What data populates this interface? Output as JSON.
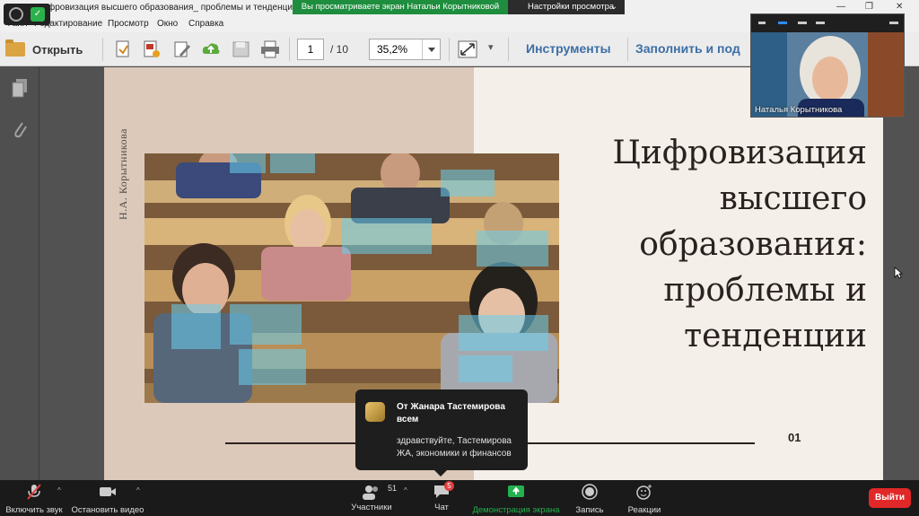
{
  "window": {
    "title": "Цифровизация высшего образования_ проблемы и тенденции.pdf - Ad"
  },
  "share_banner": {
    "text": "Вы просматриваете экран Натальи Корытниковой",
    "view_settings": "Настройки просмотра"
  },
  "menu": [
    "Файл",
    "Редактирование",
    "Просмотр",
    "Окно",
    "Справка"
  ],
  "toolbar": {
    "open_label": "Открыть",
    "page_current": "1",
    "page_total": "/ 10",
    "zoom": "35,2%",
    "tools_label": "Инструменты",
    "fill_label": "Заполнить и под"
  },
  "slide": {
    "author": "Н.А. Корытникова",
    "title_lines": [
      "Цифровизация",
      "высшего",
      "образования:",
      "проблемы и",
      "тенденции"
    ],
    "page_number": "01"
  },
  "video": {
    "participant_name": "Наталья Корытникова"
  },
  "chat_popup": {
    "from": "От Жанара Тастемирова всем",
    "message": "здравствуйте, Тастемирова ЖА, экономики и финансов"
  },
  "zoom_bar": {
    "mute_label": "Включить звук",
    "video_label": "Остановить видео",
    "participants_label": "Участники",
    "participants_count": "51",
    "chat_label": "Чат",
    "chat_badge": "5",
    "share_label": "Демонстрация экрана",
    "record_label": "Запись",
    "reactions_label": "Реакции",
    "leave_label": "Выйти"
  },
  "colors": {
    "share_green": "#1e8e3e",
    "link_blue": "#3b6ea5",
    "leave_red": "#e02828",
    "slide_bg": "#f4efe8",
    "slide_band": "#dcc9ba"
  }
}
